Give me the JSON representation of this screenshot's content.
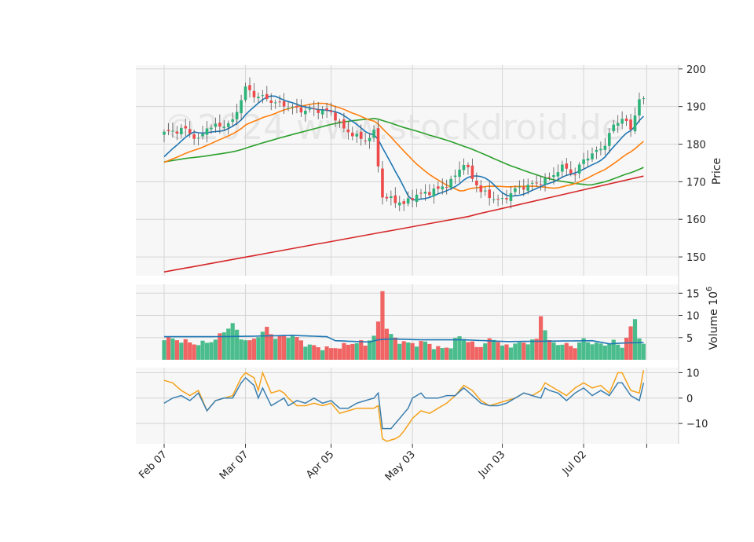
{
  "chart_data": {
    "type": "candlestick",
    "watermark": "©2024 www.stockdroid.de",
    "x_tick_labels": [
      "Feb 07",
      "Mar 07",
      "Apr 05",
      "May 03",
      "Jun 03",
      "Jul 02"
    ],
    "x_tick_indices": [
      0,
      19,
      39,
      58,
      79,
      98
    ],
    "n_bars": 113,
    "colors": {
      "up": "#2db37a",
      "down": "#ee4a4a",
      "ma_short": "#1f77b4",
      "ma_mid": "#ff7f0e",
      "ma_long": "#2ca02c",
      "ma_200": "#d62728",
      "vol_ma": "#1f77b4",
      "osc_fast": "#3b7fb0",
      "osc_slow": "#f5a21a",
      "panel_bg": "#f7f7f7",
      "grid": "#d5d5d5"
    },
    "price_panel": {
      "ylabel": "Price",
      "ylim": [
        145,
        201
      ],
      "yticks": [
        150,
        160,
        170,
        180,
        190,
        200
      ]
    },
    "volume_panel": {
      "ylabel": "Volume  10",
      "ylabel_exp": "6",
      "ylim": [
        0,
        17
      ],
      "yticks": [
        5,
        10,
        15
      ]
    },
    "oscillator_panel": {
      "ylim": [
        -18,
        12
      ],
      "yticks": [
        -10,
        0,
        10
      ],
      "ytick_labels": [
        "−10",
        "0",
        "10"
      ]
    },
    "close_keyframes": [
      [
        0,
        183
      ],
      [
        5,
        184
      ],
      [
        8,
        181
      ],
      [
        10,
        184.5
      ],
      [
        14,
        185
      ],
      [
        16,
        186
      ],
      [
        19,
        195
      ],
      [
        21,
        193
      ],
      [
        23,
        192.5
      ],
      [
        26,
        191
      ],
      [
        29,
        190
      ],
      [
        32,
        189
      ],
      [
        36,
        189
      ],
      [
        39,
        188.5
      ],
      [
        42,
        184
      ],
      [
        45,
        182
      ],
      [
        47,
        181
      ],
      [
        49,
        183
      ],
      [
        51,
        166
      ],
      [
        54,
        165
      ],
      [
        56,
        164
      ],
      [
        58,
        166
      ],
      [
        61,
        167
      ],
      [
        64,
        168
      ],
      [
        67,
        170
      ],
      [
        70,
        175
      ],
      [
        72,
        171
      ],
      [
        74,
        167.5
      ],
      [
        77,
        165.5
      ],
      [
        79,
        165
      ],
      [
        82,
        168
      ],
      [
        85,
        169
      ],
      [
        88,
        170
      ],
      [
        90,
        171
      ],
      [
        93,
        174
      ],
      [
        96,
        172
      ],
      [
        98,
        176
      ],
      [
        101,
        178
      ],
      [
        103,
        180
      ],
      [
        105,
        185
      ],
      [
        107,
        187
      ],
      [
        109,
        184
      ],
      [
        111,
        192
      ],
      [
        113,
        191
      ]
    ],
    "volume_keyframes": [
      [
        0,
        5
      ],
      [
        3,
        4.5
      ],
      [
        8,
        3.5
      ],
      [
        12,
        4.5
      ],
      [
        14,
        6.5
      ],
      [
        16,
        8
      ],
      [
        18,
        5
      ],
      [
        20,
        4
      ],
      [
        24,
        7
      ],
      [
        26,
        5
      ],
      [
        30,
        5.5
      ],
      [
        33,
        3.5
      ],
      [
        36,
        2.8
      ],
      [
        39,
        2.5
      ],
      [
        42,
        3.2
      ],
      [
        45,
        4
      ],
      [
        47,
        3.5
      ],
      [
        49,
        5.5
      ],
      [
        50,
        8
      ],
      [
        51,
        16
      ],
      [
        52,
        7
      ],
      [
        54,
        4.5
      ],
      [
        56,
        4
      ],
      [
        58,
        3.5
      ],
      [
        61,
        4
      ],
      [
        64,
        2.5
      ],
      [
        67,
        3
      ],
      [
        69,
        5.5
      ],
      [
        72,
        3.5
      ],
      [
        74,
        3
      ],
      [
        77,
        5
      ],
      [
        79,
        3
      ],
      [
        82,
        3.5
      ],
      [
        85,
        4
      ],
      [
        87,
        4.5
      ],
      [
        88,
        10
      ],
      [
        90,
        4
      ],
      [
        93,
        3.5
      ],
      [
        96,
        3
      ],
      [
        98,
        4.5
      ],
      [
        101,
        3.5
      ],
      [
        103,
        3.5
      ],
      [
        105,
        4
      ],
      [
        107,
        3
      ],
      [
        109,
        7
      ],
      [
        110,
        9.5
      ],
      [
        111,
        5
      ],
      [
        113,
        2
      ]
    ],
    "volume_ma_keyframes": [
      [
        0,
        5.2
      ],
      [
        10,
        5.2
      ],
      [
        20,
        5.3
      ],
      [
        30,
        5.5
      ],
      [
        38,
        5.2
      ],
      [
        40,
        4.3
      ],
      [
        48,
        4
      ],
      [
        50,
        4.5
      ],
      [
        53,
        4.7
      ],
      [
        60,
        4.5
      ],
      [
        70,
        4.5
      ],
      [
        80,
        4.1
      ],
      [
        90,
        4.2
      ],
      [
        100,
        4.3
      ],
      [
        104,
        3.6
      ],
      [
        108,
        3.8
      ],
      [
        113,
        3.9
      ]
    ],
    "osc_fast_keyframes": [
      [
        0,
        -2
      ],
      [
        2,
        0
      ],
      [
        4,
        1
      ],
      [
        6,
        -1
      ],
      [
        8,
        2
      ],
      [
        10,
        -5
      ],
      [
        12,
        -1
      ],
      [
        14,
        0
      ],
      [
        16,
        0
      ],
      [
        18,
        6
      ],
      [
        19,
        8
      ],
      [
        21,
        5
      ],
      [
        22,
        0
      ],
      [
        23,
        4
      ],
      [
        25,
        -3
      ],
      [
        27,
        -1
      ],
      [
        28,
        0
      ],
      [
        29,
        -3
      ],
      [
        31,
        -1
      ],
      [
        33,
        -2
      ],
      [
        35,
        0
      ],
      [
        37,
        -2
      ],
      [
        39,
        -1
      ],
      [
        41,
        -4
      ],
      [
        43,
        -4
      ],
      [
        45,
        -2
      ],
      [
        47,
        -1
      ],
      [
        49,
        0
      ],
      [
        50,
        2
      ],
      [
        51,
        -12
      ],
      [
        53,
        -12
      ],
      [
        55,
        -8
      ],
      [
        57,
        -4
      ],
      [
        58,
        0
      ],
      [
        60,
        2
      ],
      [
        61,
        0
      ],
      [
        64,
        0
      ],
      [
        66,
        1
      ],
      [
        68,
        1
      ],
      [
        70,
        4
      ],
      [
        72,
        1
      ],
      [
        74,
        -2
      ],
      [
        76,
        -3
      ],
      [
        78,
        -3
      ],
      [
        80,
        -2
      ],
      [
        82,
        0
      ],
      [
        84,
        2
      ],
      [
        86,
        1
      ],
      [
        88,
        0
      ],
      [
        89,
        4
      ],
      [
        90,
        3
      ],
      [
        92,
        2
      ],
      [
        94,
        -1
      ],
      [
        96,
        2
      ],
      [
        98,
        4
      ],
      [
        100,
        1
      ],
      [
        102,
        3
      ],
      [
        104,
        1
      ],
      [
        106,
        6
      ],
      [
        107,
        6
      ],
      [
        109,
        1
      ],
      [
        111,
        -1
      ],
      [
        112,
        6
      ],
      [
        113,
        3
      ]
    ],
    "osc_slow_keyframes": [
      [
        0,
        7
      ],
      [
        2,
        6
      ],
      [
        4,
        3
      ],
      [
        6,
        1
      ],
      [
        8,
        3
      ],
      [
        10,
        -5
      ],
      [
        12,
        -1
      ],
      [
        14,
        0
      ],
      [
        16,
        1
      ],
      [
        18,
        8
      ],
      [
        19,
        10
      ],
      [
        21,
        8
      ],
      [
        22,
        3
      ],
      [
        23,
        10
      ],
      [
        25,
        2
      ],
      [
        27,
        3
      ],
      [
        28,
        2
      ],
      [
        29,
        0
      ],
      [
        31,
        -3
      ],
      [
        33,
        -3
      ],
      [
        35,
        -2
      ],
      [
        37,
        -3
      ],
      [
        39,
        -2
      ],
      [
        41,
        -6
      ],
      [
        43,
        -5
      ],
      [
        45,
        -4
      ],
      [
        47,
        -4
      ],
      [
        49,
        -4
      ],
      [
        50,
        -3
      ],
      [
        51,
        -16
      ],
      [
        52,
        -17
      ],
      [
        54,
        -16
      ],
      [
        55,
        -15
      ],
      [
        56,
        -13
      ],
      [
        58,
        -8
      ],
      [
        60,
        -5
      ],
      [
        62,
        -6
      ],
      [
        64,
        -4
      ],
      [
        66,
        -2
      ],
      [
        68,
        1
      ],
      [
        70,
        5
      ],
      [
        72,
        3
      ],
      [
        74,
        -1
      ],
      [
        76,
        -3
      ],
      [
        78,
        -2
      ],
      [
        80,
        -1
      ],
      [
        82,
        0
      ],
      [
        84,
        2
      ],
      [
        86,
        1
      ],
      [
        88,
        3
      ],
      [
        89,
        6
      ],
      [
        90,
        5
      ],
      [
        92,
        3
      ],
      [
        94,
        1
      ],
      [
        96,
        4
      ],
      [
        98,
        6
      ],
      [
        100,
        4
      ],
      [
        102,
        5
      ],
      [
        104,
        2
      ],
      [
        106,
        10
      ],
      [
        107,
        10
      ],
      [
        109,
        3
      ],
      [
        111,
        2
      ],
      [
        112,
        11
      ],
      [
        113,
        8
      ]
    ]
  }
}
